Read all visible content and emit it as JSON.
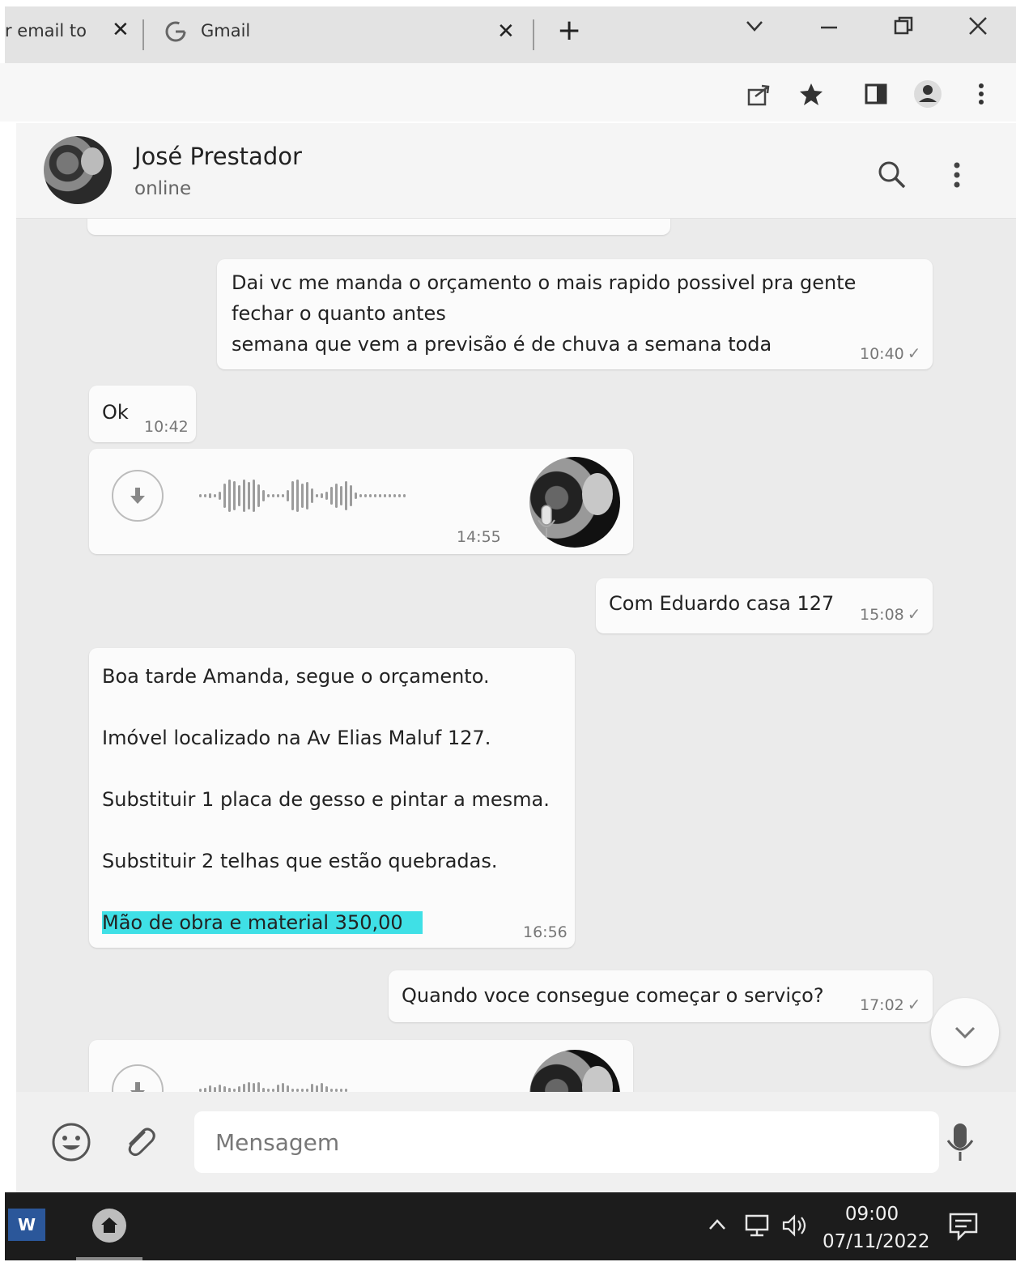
{
  "browser": {
    "prev_tab_title": "r email to",
    "tab_title": "Gmail",
    "tab_favicon": "google-g-icon",
    "close_glyph": "✕",
    "newtab_glyph": "+"
  },
  "chat": {
    "contact_name": "José Prestador",
    "contact_status": "online",
    "messages": [
      {
        "side": "out",
        "text": "Dai vc me manda o orçamento o mais rapido possivel pra gente\nfechar o quanto antes\nsemana que vem a previsão é de chuva a semana toda",
        "time": "10:40"
      },
      {
        "side": "in",
        "text": "Ok",
        "time": "10:42"
      },
      {
        "side": "in",
        "type": "voice",
        "time": "14:55"
      },
      {
        "side": "out",
        "text": "Com Eduardo casa 127",
        "time": "15:08"
      },
      {
        "side": "in",
        "lines": [
          "Boa tarde Amanda, segue o orçamento.",
          "Imóvel localizado na Av Elias Maluf 127.",
          "Substituir 1 placa de gesso e pintar a mesma.",
          "Substituir 2 telhas que estão quebradas."
        ],
        "highlighted_line": "Mão de obra e material 350,00",
        "time": "16:56"
      },
      {
        "side": "out",
        "text": "Quando voce consegue começar o serviço?",
        "time": "17:02"
      },
      {
        "side": "in",
        "type": "voice"
      }
    ]
  },
  "composer": {
    "placeholder": "Mensagem"
  },
  "taskbar": {
    "time": "09:00",
    "date": "07/11/2022",
    "word_label": "W"
  },
  "colors": {
    "highlight": "#3fe0e6",
    "bubble": "#fbfbfb",
    "chat_background": "#ebebeb",
    "taskbar": "#1c1c1c"
  }
}
